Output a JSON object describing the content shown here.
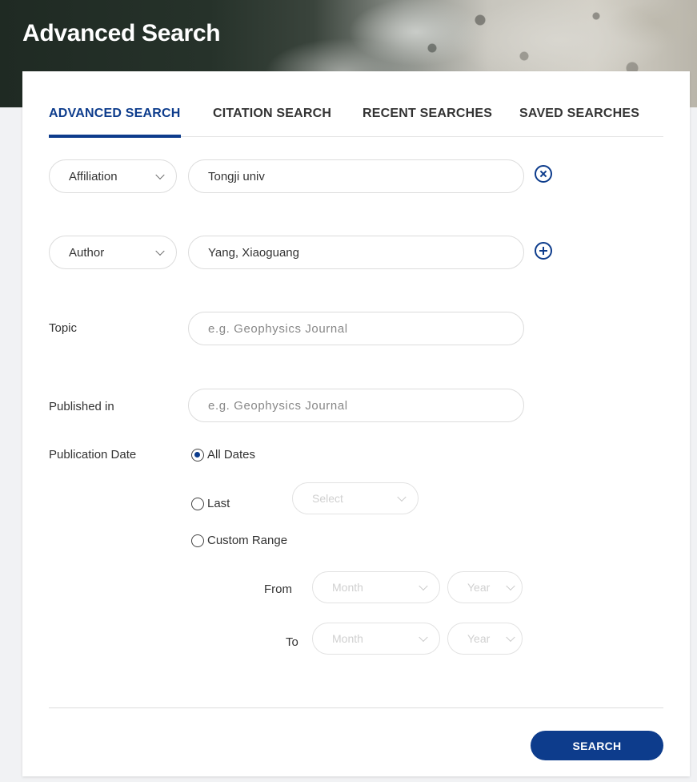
{
  "header": {
    "title": "Advanced Search"
  },
  "tabs": [
    {
      "label": "ADVANCED SEARCH",
      "active": true
    },
    {
      "label": "CITATION SEARCH",
      "active": false
    },
    {
      "label": "RECENT SEARCHES",
      "active": false
    },
    {
      "label": "SAVED SEARCHES",
      "active": false
    }
  ],
  "rows": [
    {
      "field": "Affiliation",
      "value": "Tongji univ",
      "action_icon": "close-circle-icon"
    },
    {
      "field": "Author",
      "value": "Yang, Xiaoguang",
      "action_icon": "plus-circle-icon"
    }
  ],
  "topic": {
    "label": "Topic",
    "placeholder": "e.g. Geophysics Journal"
  },
  "published_in": {
    "label": "Published in",
    "placeholder": "e.g. Geophysics Journal"
  },
  "publication_date": {
    "label": "Publication Date",
    "options": [
      {
        "label": "All Dates",
        "checked": true
      },
      {
        "label": "Last",
        "checked": false
      },
      {
        "label": "Custom Range",
        "checked": false
      }
    ],
    "last_select_placeholder": "Select",
    "from_label": "From",
    "to_label": "To",
    "month_placeholder": "Month",
    "year_placeholder": "Year"
  },
  "search_button": {
    "label": "SEARCH"
  },
  "colors": {
    "accent": "#0d3c8c",
    "text": "#333333",
    "border": "#dcdcdc"
  }
}
